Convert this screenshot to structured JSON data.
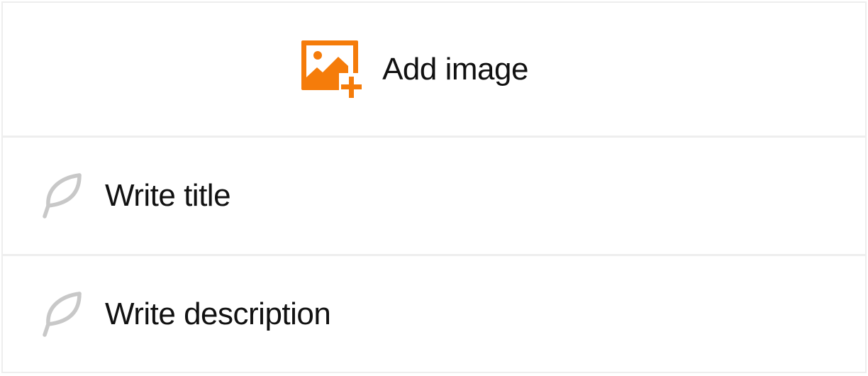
{
  "colors": {
    "accent": "#F57C0A",
    "icon_muted": "#C8C8C8",
    "divider": "#EEEEEE",
    "text": "#111111"
  },
  "add_image": {
    "label": "Add image",
    "icon": "image-add-icon"
  },
  "fields": {
    "title": {
      "label": "Write title",
      "icon": "feather-icon"
    },
    "description": {
      "label": "Write description",
      "icon": "feather-icon"
    }
  }
}
